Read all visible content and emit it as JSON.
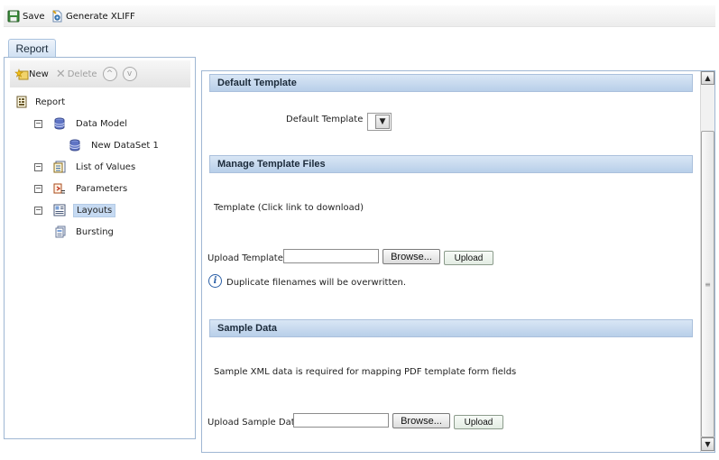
{
  "toolbar": {
    "save_label": "Save",
    "generate_xliff_label": "Generate XLIFF"
  },
  "tab": {
    "label": "Report"
  },
  "tree_toolbar": {
    "new_label": "New",
    "delete_label": "Delete",
    "up_icon": "^",
    "down_icon": "v"
  },
  "tree": {
    "root": "Report",
    "items": [
      {
        "label": "Data Model",
        "expander": "−"
      },
      {
        "label": "New DataSet 1"
      },
      {
        "label": "List of Values",
        "expander": "−"
      },
      {
        "label": "Parameters",
        "expander": "−"
      },
      {
        "label": "Layouts",
        "expander": "−",
        "selected": true
      },
      {
        "label": "Bursting"
      }
    ]
  },
  "main": {
    "default_template_section": {
      "title": "Default Template",
      "field_label": "Default Template",
      "selected_value": ""
    },
    "manage_templates_section": {
      "title": "Manage Template Files",
      "template_hint": "Template (Click link to download)",
      "upload_label": "Upload Template:",
      "browse_label": "Browse...",
      "upload_button": "Upload",
      "info_text": "Duplicate filenames will be overwritten."
    },
    "sample_data_section": {
      "title": "Sample Data",
      "description": "Sample XML data is required for mapping PDF template form fields",
      "upload_label": "Upload Sample Data",
      "browse_label": "Browse...",
      "upload_button": "Upload"
    }
  },
  "colors": {
    "section_header_top": "#d9e6f5",
    "section_header_bottom": "#b8cfe9",
    "selected_item": "#c6daf2",
    "panel_border": "#9fb7d3"
  }
}
